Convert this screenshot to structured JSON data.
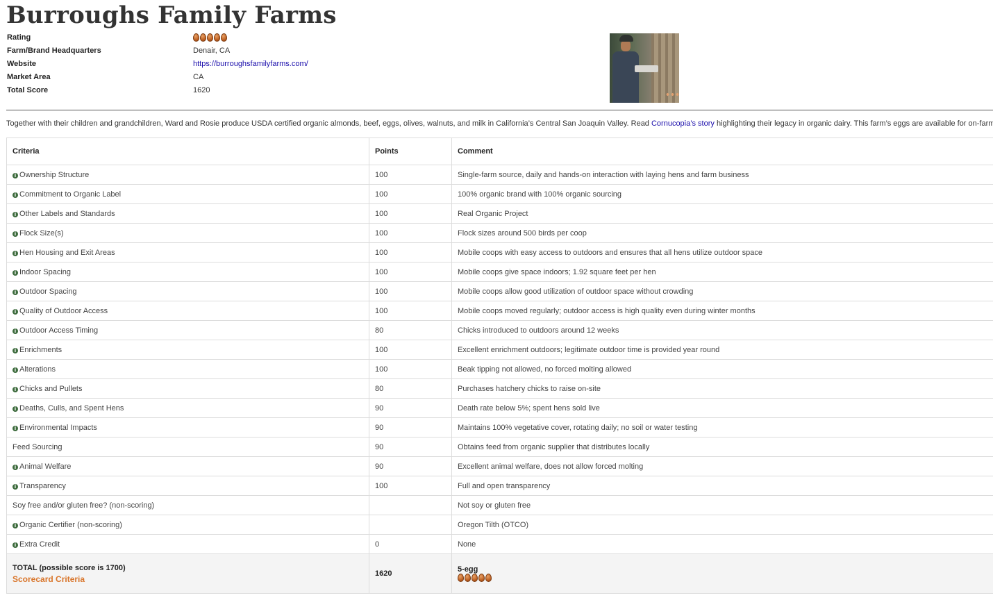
{
  "title": "Burroughs Family Farms",
  "info": {
    "rating_label": "Rating",
    "rating_eggs": 5,
    "hq_label": "Farm/Brand Headquarters",
    "hq_value": "Denair, CA",
    "website_label": "Website",
    "website_value": "https://burroughsfamilyfarms.com/",
    "market_label": "Market Area",
    "market_value": "CA",
    "score_label": "Total Score",
    "score_value": "1620"
  },
  "description": {
    "before": "Together with their children and grandchildren, Ward and Rosie produce USDA certified organic almonds, beef, eggs, olives, walnuts, and milk in California’s Central San Joaquin Valley. Read ",
    "link": "Cornucopia’s story",
    "after": " highlighting their legacy in organic dairy. This farm’s eggs are available for on-farm pickup only."
  },
  "table": {
    "headers": {
      "criteria": "Criteria",
      "points": "Points",
      "comment": "Comment"
    },
    "rows": [
      {
        "criteria": "Ownership Structure",
        "points": "100",
        "comment": "Single-farm source, daily and hands-on interaction with laying hens and farm business",
        "info": true
      },
      {
        "criteria": "Commitment to Organic Label",
        "points": "100",
        "comment": "100% organic brand with 100% organic sourcing",
        "info": true
      },
      {
        "criteria": "Other Labels and Standards",
        "points": "100",
        "comment": "Real Organic Project",
        "info": true
      },
      {
        "criteria": "Flock Size(s)",
        "points": "100",
        "comment": "Flock sizes around 500 birds per coop",
        "info": true
      },
      {
        "criteria": "Hen Housing and Exit Areas",
        "points": "100",
        "comment": "Mobile coops with easy access to outdoors and ensures that all hens utilize outdoor space",
        "info": true
      },
      {
        "criteria": "Indoor Spacing",
        "points": "100",
        "comment": "Mobile coops give space indoors; 1.92 square feet per hen",
        "info": true
      },
      {
        "criteria": "Outdoor Spacing",
        "points": "100",
        "comment": "Mobile coops allow good utilization of outdoor space without crowding",
        "info": true
      },
      {
        "criteria": "Quality of Outdoor Access",
        "points": "100",
        "comment": "Mobile coops moved regularly; outdoor access is high quality even during winter months",
        "info": true
      },
      {
        "criteria": "Outdoor Access Timing",
        "points": "80",
        "comment": "Chicks introduced to outdoors around 12 weeks",
        "info": true
      },
      {
        "criteria": "Enrichments",
        "points": "100",
        "comment": "Excellent enrichment outdoors; legitimate outdoor time is provided year round",
        "info": true
      },
      {
        "criteria": "Alterations",
        "points": "100",
        "comment": "Beak tipping not allowed, no forced molting allowed",
        "info": true
      },
      {
        "criteria": "Chicks and Pullets",
        "points": "80",
        "comment": "Purchases hatchery chicks to raise on-site",
        "info": true
      },
      {
        "criteria": "Deaths, Culls, and Spent Hens",
        "points": "90",
        "comment": "Death rate below 5%; spent hens sold live",
        "info": true
      },
      {
        "criteria": "Environmental Impacts",
        "points": "90",
        "comment": "Maintains 100% vegetative cover, rotating daily; no soil or water testing",
        "info": true
      },
      {
        "criteria": "Feed Sourcing",
        "points": "90",
        "comment": "Obtains feed from organic supplier that distributes locally",
        "info": false
      },
      {
        "criteria": "Animal Welfare",
        "points": "90",
        "comment": "Excellent animal welfare, does not allow forced molting",
        "info": true
      },
      {
        "criteria": "Transparency",
        "points": "100",
        "comment": "Full and open transparency",
        "info": true
      },
      {
        "criteria": "Soy free and/or gluten free? (non-scoring)",
        "points": "",
        "comment": "Not soy or gluten free",
        "info": false
      },
      {
        "criteria": "Organic Certifier (non-scoring)",
        "points": "",
        "comment": "Oregon Tilth (OTCO)",
        "info": true
      },
      {
        "criteria": "Extra Credit",
        "points": "0",
        "comment": "None",
        "info": true
      }
    ],
    "footer": {
      "total_label": "TOTAL (possible score is 1700)",
      "criteria_link": "Scorecard Criteria",
      "total_points": "1620",
      "rating_text": "5-egg",
      "rating_eggs": 5
    }
  },
  "colors": {
    "accent_link": "#1a0dab",
    "criteria_link": "#d9752a",
    "info_icon": "#3d6b3d",
    "egg": "#b95b1e"
  }
}
